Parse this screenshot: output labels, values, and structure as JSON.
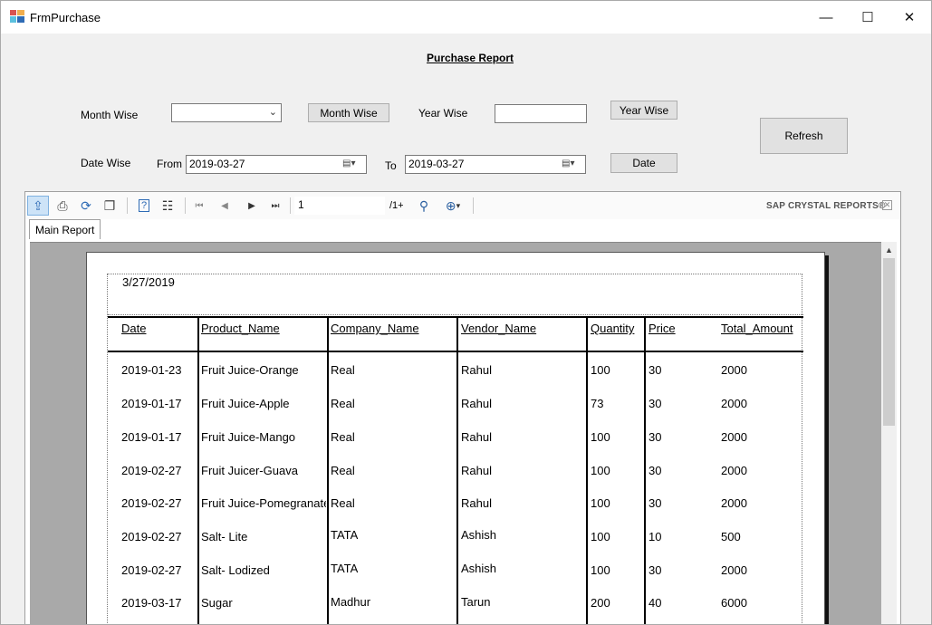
{
  "window": {
    "title": "FrmPurchase",
    "minimize": "—",
    "maximize": "☐",
    "close": "✕"
  },
  "form": {
    "report_title": "Purchase Report",
    "month_wise_label": "Month Wise",
    "month_wise_value": "",
    "month_wise_button": "Month Wise",
    "year_wise_label": "Year Wise",
    "year_wise_value": "",
    "year_wise_button": "Year Wise",
    "refresh_button": "Refresh",
    "date_wise_label": "Date Wise",
    "from_label": "From",
    "from_value": "2019-03-27",
    "to_label": "To",
    "to_value": "2019-03-27",
    "date_button": "Date"
  },
  "viewer": {
    "page_number": "1",
    "page_total": "/1+",
    "brand": "SAP CRYSTAL REPORTS®",
    "tab_main_report": "Main Report",
    "icons": [
      "export-icon",
      "print-icon",
      "refresh-icon",
      "copy-icon",
      "help-icon",
      "group-tree-icon",
      "first-page-icon",
      "previous-page-icon",
      "next-page-icon",
      "last-page-icon",
      "find-icon",
      "zoom-icon"
    ]
  },
  "report": {
    "print_date": "3/27/2019",
    "headers": [
      "Date",
      "Product_Name",
      "Company_Name",
      "Vendor_Name",
      "Quantity",
      "Price",
      "Total_Amount"
    ],
    "rows": [
      [
        "2019-01-23",
        "Fruit Juice-Orange",
        "Real",
        "Rahul",
        "100",
        "30",
        "2000"
      ],
      [
        "2019-01-17",
        "Fruit Juice-Apple",
        "Real",
        "Rahul",
        "73",
        "30",
        "2000"
      ],
      [
        "2019-01-17",
        "Fruit Juice-Mango",
        "Real",
        "Rahul",
        "100",
        "30",
        "2000"
      ],
      [
        "2019-02-27",
        "Fruit Juicer-Guava",
        "Real",
        "Rahul",
        "100",
        "30",
        "2000"
      ],
      [
        "2019-02-27",
        "Fruit Juice-Pomegranate",
        "Real",
        "Rahul",
        "100",
        "30",
        "2000"
      ],
      [
        "2019-02-27",
        "Salt- Lite",
        "TATA",
        "Ashish",
        "100",
        "10",
        "500"
      ],
      [
        "2019-02-27",
        "Salt- Lodized",
        "TATA",
        "Ashish",
        "100",
        "30",
        "2000"
      ],
      [
        "2019-03-17",
        "Sugar",
        "Madhur",
        "Tarun",
        "200",
        "40",
        "6000"
      ]
    ]
  }
}
